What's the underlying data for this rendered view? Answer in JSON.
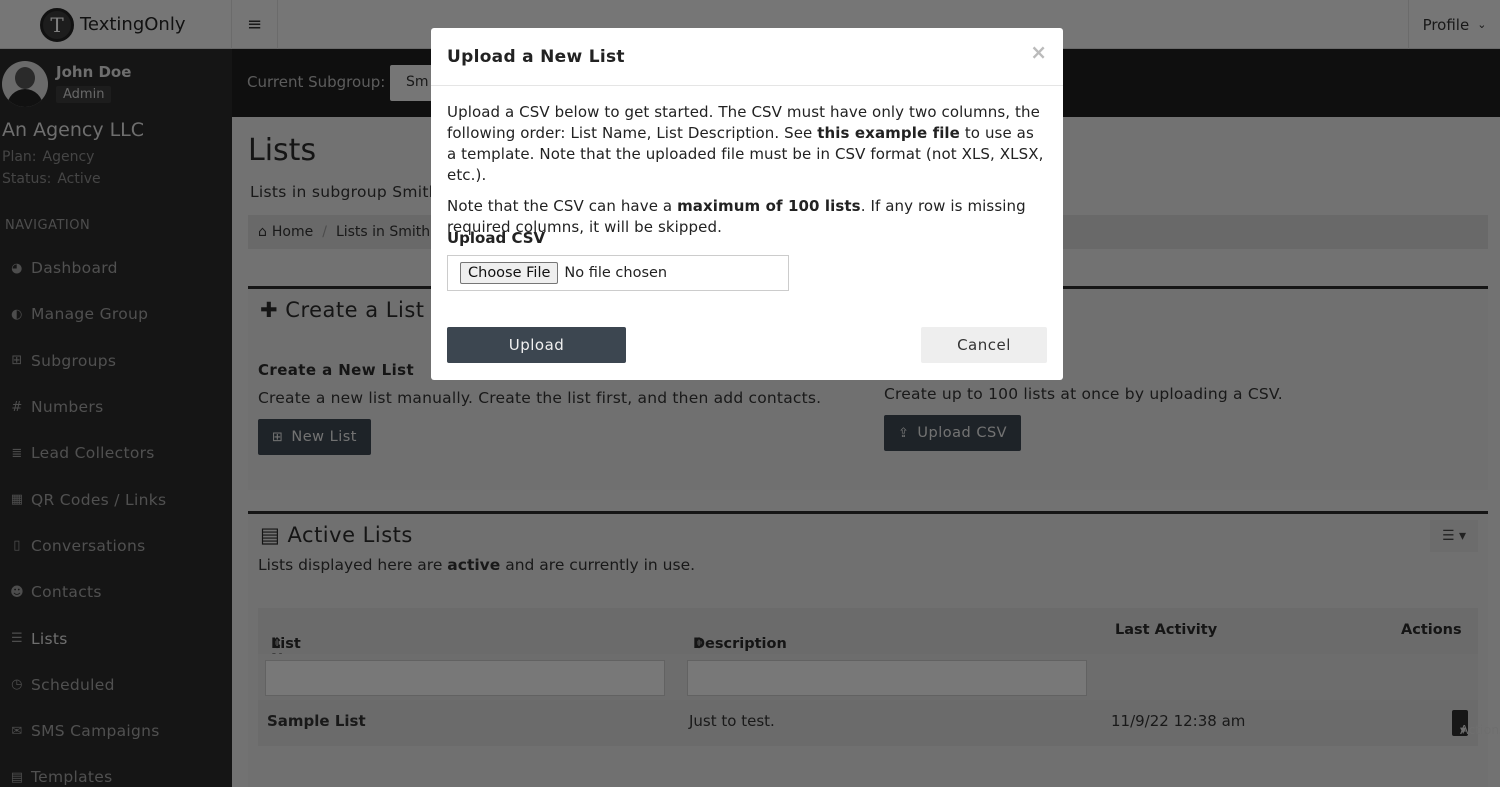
{
  "topbar": {
    "brand_logo_letter": "T",
    "brand_name": "TextingOnly",
    "menu_icon": "hamburger-icon",
    "profile_label": "Profile"
  },
  "subheader": {
    "label": "Current Subgroup:",
    "select_value": "Sm"
  },
  "sidebar": {
    "user_name": "John Doe",
    "user_role": "Admin",
    "agency": "An Agency LLC",
    "plan_label": "Plan:",
    "plan_value": "Agency",
    "status_label": "Status:",
    "status_value": "Active",
    "nav_title": "NAVIGATION",
    "items": [
      {
        "label": "Dashboard",
        "icon": "dashboard-icon"
      },
      {
        "label": "Manage Group",
        "icon": "adjust-icon"
      },
      {
        "label": "Subgroups",
        "icon": "sitemap-icon"
      },
      {
        "label": "Numbers",
        "icon": "hash-icon"
      },
      {
        "label": "Lead Collectors",
        "icon": "database-icon"
      },
      {
        "label": "QR Codes / Links",
        "icon": "qr-code-icon"
      },
      {
        "label": "Conversations",
        "icon": "mobile-icon"
      },
      {
        "label": "Contacts",
        "icon": "users-icon"
      },
      {
        "label": "Lists",
        "icon": "list-icon"
      },
      {
        "label": "Scheduled",
        "icon": "clock-icon"
      },
      {
        "label": "SMS Campaigns",
        "icon": "comments-icon"
      },
      {
        "label": "Templates",
        "icon": "file-icon"
      }
    ]
  },
  "main": {
    "title": "Lists",
    "subtitle": "Lists in subgroup Smith",
    "breadcrumb": {
      "home": "Home",
      "current": "Lists in Smith"
    },
    "create_panel": {
      "title": "Create a List",
      "left_heading": "Create a New List",
      "left_text": "Create a new list manually. Create the list first, and then add contacts.",
      "left_button": "New List",
      "right_text": "Create up to 100 lists at once by uploading a CSV.",
      "right_button": "Upload CSV"
    },
    "lists_panel": {
      "title": "Active Lists",
      "desc_pre": "Lists displayed here are ",
      "desc_bold": "active",
      "desc_post": " and are currently in use.",
      "columns": [
        "List Name",
        "Description",
        "Last Activity",
        "Actions"
      ],
      "rows": [
        {
          "name": "Sample List",
          "description": "Just to test.",
          "last_activity": "11/9/22 12:38 am",
          "action": "Actions"
        }
      ]
    }
  },
  "modal": {
    "title": "Upload a New List",
    "close": "×",
    "p1_a": "Upload a CSV below to get started. The CSV must have only two columns, the following order: List Name, List Description. See ",
    "p1_link": "this example file",
    "p1_b": " to use as a template. Note that the uploaded file must be in CSV format (not XLS, XLSX, etc.).",
    "p2_a": "Note that the CSV can have a ",
    "p2_bold": "maximum of 100 lists",
    "p2_b": ". If any row is missing required columns, it will be skipped.",
    "upload_label": "Upload CSV",
    "choose_file": "Choose File",
    "no_file": "No file chosen",
    "upload_button": "Upload",
    "cancel_button": "Cancel"
  }
}
